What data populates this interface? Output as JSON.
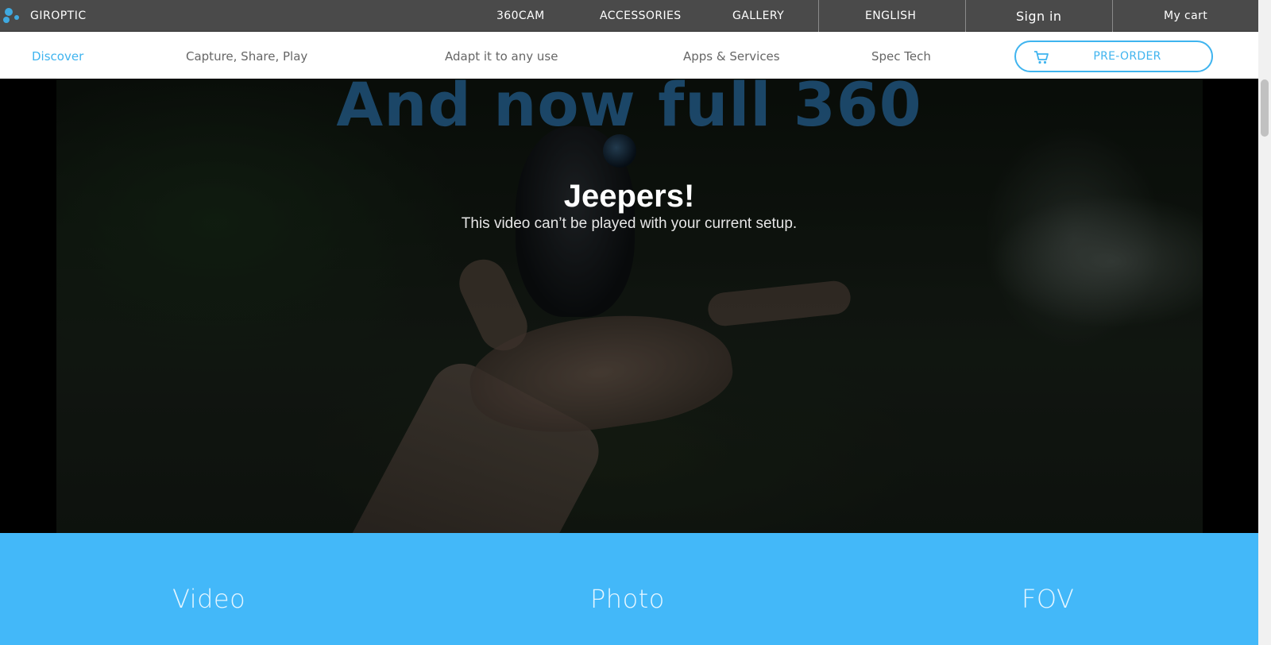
{
  "brand": {
    "name": "GIROPTIC",
    "logo": "giroptic-dots-logo"
  },
  "topnav": {
    "items": [
      "360CAM",
      "ACCESSORIES",
      "GALLERY"
    ],
    "language": "ENGLISH",
    "sign_in": "Sign in",
    "cart": "My cart"
  },
  "subnav": {
    "items": [
      "Discover",
      "Capture, Share, Play",
      "Adapt it to any use",
      "Apps & Services",
      "Spec Tech"
    ],
    "active": "Discover",
    "preorder_label": "PRE-ORDER",
    "preorder_icon": "cart-icon"
  },
  "hero": {
    "title": "And now full 360",
    "error_title": "Jeepers!",
    "error_message": "This video can’t be played with your current setup."
  },
  "features": {
    "items": [
      "Video",
      "Photo",
      "FOV"
    ]
  },
  "colors": {
    "accent": "#3fb4ef",
    "topbar": "#4a4a4a",
    "features_bg": "#43b8f9",
    "title": "#1e4d72"
  }
}
